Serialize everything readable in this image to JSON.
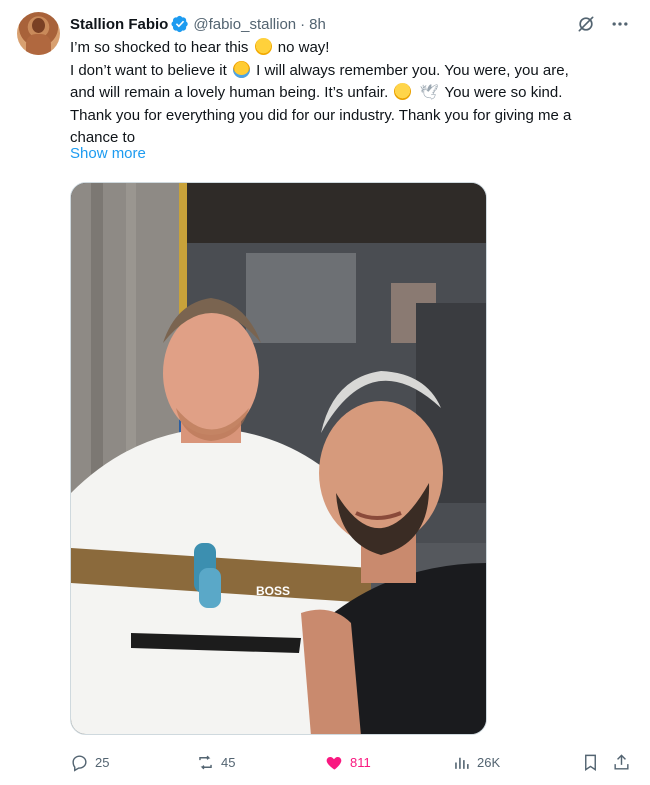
{
  "author": {
    "display_name": "Stallion Fabio",
    "handle": "@fabio_stallion",
    "separator": "·",
    "time": "8h",
    "avatar_icon": "profile-photo",
    "verified_icon": "verified-badge-icon"
  },
  "tweet": {
    "lines": [
      [
        "I’m so shocked to hear this ",
        " no way!"
      ],
      [
        "I don’t want to believe it ",
        " I will always remember you. You were, you are,"
      ],
      [
        "and will remain a lovely human being. It’s unfair. ",
        " ",
        " You were so kind."
      ],
      [
        "Thank you for everything you did for our industry. Thank you for giving me a"
      ],
      [
        "chance to"
      ]
    ],
    "show_more": "Show more"
  },
  "stats": {
    "replies": "25",
    "reposts": "45",
    "likes": "811",
    "views": "26K"
  },
  "colors": {
    "accent": "#1d9bf0",
    "like": "#f91880",
    "muted": "#536471",
    "text": "#0f1419"
  },
  "icons": {
    "grok": "grok-icon",
    "more": "more-icon",
    "reply": "reply-icon",
    "repost": "repost-icon",
    "like": "heart-icon",
    "views": "views-icon",
    "bookmark": "bookmark-icon",
    "share": "share-icon"
  }
}
